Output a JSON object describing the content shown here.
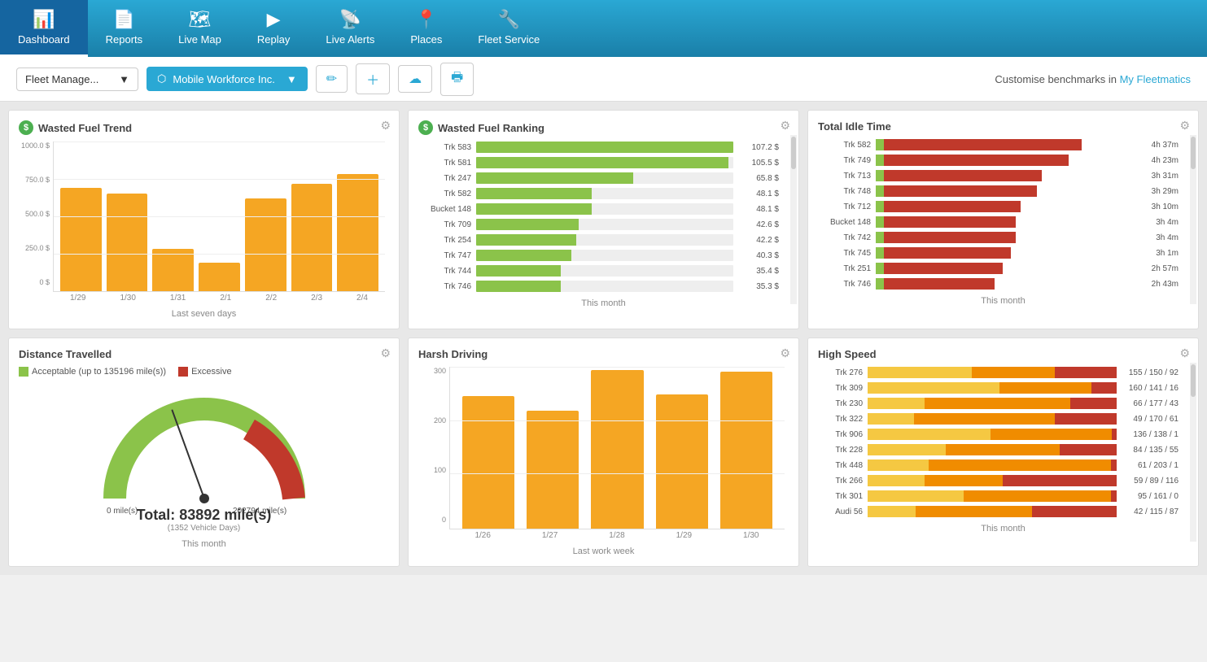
{
  "header": {
    "nav": [
      {
        "id": "dashboard",
        "label": "Dashboard",
        "icon": "📊",
        "active": true
      },
      {
        "id": "reports",
        "label": "Reports",
        "icon": "📄"
      },
      {
        "id": "live-map",
        "label": "Live Map",
        "icon": "🗺"
      },
      {
        "id": "replay",
        "label": "Replay",
        "icon": "▶"
      },
      {
        "id": "live-alerts",
        "label": "Live Alerts",
        "icon": "📡"
      },
      {
        "id": "places",
        "label": "Places",
        "icon": "📍"
      },
      {
        "id": "fleet-service",
        "label": "Fleet Service",
        "icon": "🔧"
      }
    ]
  },
  "toolbar": {
    "group_label": "Fleet Manage...",
    "company_label": "Mobile Workforce Inc.",
    "customize_text": "Customise benchmarks in ",
    "customize_link": "My Fleetmatics"
  },
  "widgets": {
    "wasted_fuel_trend": {
      "title": "Wasted Fuel Trend",
      "footer": "Last seven days",
      "y_labels": [
        "1000.0 $",
        "750.0 $",
        "500.0 $",
        "250.0 $",
        "0 $"
      ],
      "x_labels": [
        "1/29",
        "1/30",
        "1/31",
        "2/1",
        "2/2",
        "2/3",
        "2/4"
      ],
      "bars": [
        0.69,
        0.65,
        0.28,
        0.19,
        0.62,
        0.72,
        0.78
      ]
    },
    "wasted_fuel_ranking": {
      "title": "Wasted Fuel Ranking",
      "footer": "This month",
      "rows": [
        {
          "label": "Trk 583",
          "value": "107.2 $",
          "pct": 100
        },
        {
          "label": "Trk 581",
          "value": "105.5 $",
          "pct": 98
        },
        {
          "label": "Trk 247",
          "value": "65.8 $",
          "pct": 61
        },
        {
          "label": "Trk 582",
          "value": "48.1 $",
          "pct": 45
        },
        {
          "label": "Bucket 148",
          "value": "48.1 $",
          "pct": 45
        },
        {
          "label": "Trk 709",
          "value": "42.6 $",
          "pct": 40
        },
        {
          "label": "Trk 254",
          "value": "42.2 $",
          "pct": 39
        },
        {
          "label": "Trk 747",
          "value": "40.3 $",
          "pct": 37
        },
        {
          "label": "Trk 744",
          "value": "35.4 $",
          "pct": 33
        },
        {
          "label": "Trk 746",
          "value": "35.3 $",
          "pct": 33
        }
      ]
    },
    "total_idle_time": {
      "title": "Total Idle Time",
      "footer": "This month",
      "rows": [
        {
          "label": "Trk 582",
          "value": "4h 37m",
          "green": 10,
          "red": 75
        },
        {
          "label": "Trk 749",
          "value": "4h 23m",
          "green": 10,
          "red": 70
        },
        {
          "label": "Trk 713",
          "value": "3h 31m",
          "green": 10,
          "red": 60
        },
        {
          "label": "Trk 748",
          "value": "3h 29m",
          "green": 10,
          "red": 58
        },
        {
          "label": "Trk 712",
          "value": "3h 10m",
          "green": 10,
          "red": 52
        },
        {
          "label": "Bucket 148",
          "value": "3h 4m",
          "green": 10,
          "red": 50
        },
        {
          "label": "Trk 742",
          "value": "3h 4m",
          "green": 10,
          "red": 50
        },
        {
          "label": "Trk 745",
          "value": "3h 1m",
          "green": 10,
          "red": 48
        },
        {
          "label": "Trk 251",
          "value": "2h 57m",
          "green": 10,
          "red": 45
        },
        {
          "label": "Trk 746",
          "value": "2h 43m",
          "green": 10,
          "red": 42
        }
      ]
    },
    "distance_travelled": {
      "title": "Distance Travelled",
      "footer": "This month",
      "legend_green": "Acceptable (up to 135196 mile(s))",
      "legend_red": "Excessive",
      "total_label": "Total: 83892 mile(s)",
      "subtitle": "(1352 Vehicle Days)",
      "min_label": "0 mile(s)",
      "max_label": "202794 mile(s)",
      "needle_angle": -15
    },
    "harsh_driving": {
      "title": "Harsh Driving",
      "footer": "Last work week",
      "y_labels": [
        "300",
        "200",
        "100",
        "0"
      ],
      "x_labels": [
        "1/26",
        "1/27",
        "1/28",
        "1/29",
        "1/30"
      ],
      "bars": [
        0.82,
        0.73,
        0.98,
        0.83,
        0.97
      ]
    },
    "high_speed": {
      "title": "High Speed",
      "footer": "This month",
      "rows": [
        {
          "label": "Trk 276",
          "value": "155 / 150 / 92",
          "y": 50,
          "o": 40,
          "r": 30
        },
        {
          "label": "Trk 309",
          "value": "160 / 141 / 16",
          "y": 52,
          "o": 36,
          "r": 10
        },
        {
          "label": "Trk 230",
          "value": "66 / 177 / 43",
          "y": 22,
          "o": 56,
          "r": 18
        },
        {
          "label": "Trk 322",
          "value": "49 / 170 / 61",
          "y": 18,
          "o": 54,
          "r": 24
        },
        {
          "label": "Trk 906",
          "value": "136 / 138 / 1",
          "y": 48,
          "o": 47,
          "r": 2
        },
        {
          "label": "Trk 228",
          "value": "84 / 135 / 55",
          "y": 30,
          "o": 44,
          "r": 22
        },
        {
          "label": "Trk 448",
          "value": "61 / 203 / 1",
          "y": 22,
          "o": 66,
          "r": 2
        },
        {
          "label": "Trk 266",
          "value": "59 / 89 / 116",
          "y": 22,
          "o": 30,
          "r": 44
        },
        {
          "label": "Trk 301",
          "value": "95 / 161 / 0",
          "y": 34,
          "o": 52,
          "r": 2
        },
        {
          "label": "Audi 56",
          "value": "42 / 115 / 87",
          "y": 18,
          "o": 44,
          "r": 32
        }
      ]
    }
  }
}
